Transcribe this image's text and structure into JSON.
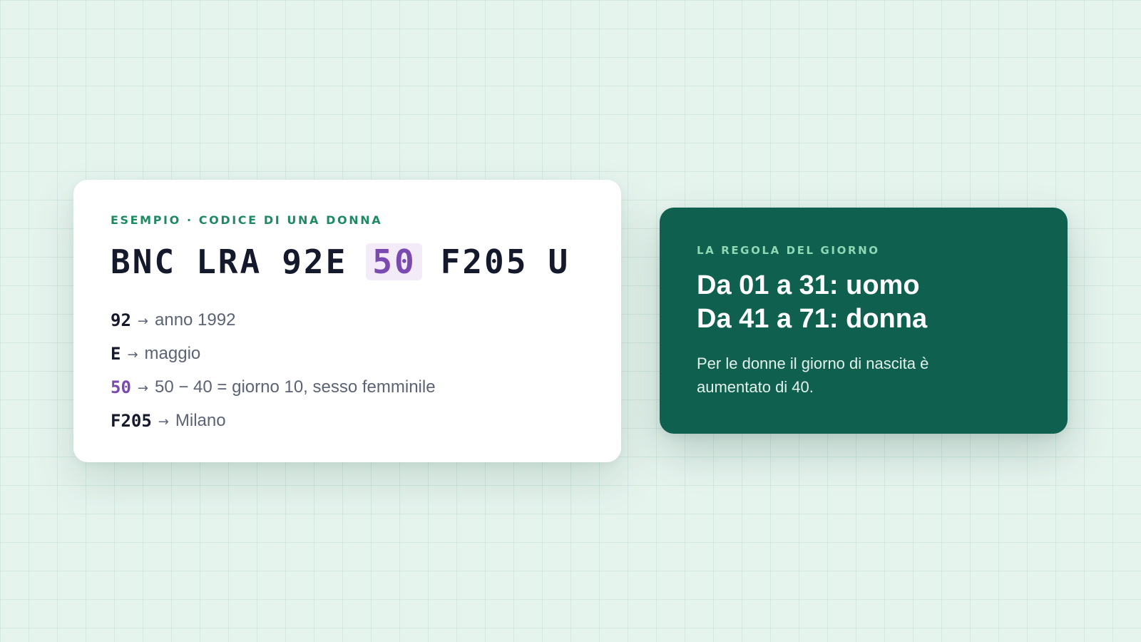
{
  "example": {
    "eyebrow": "ESEMPIO · CODICE DI UNA DONNA",
    "code": {
      "surname": "BNC",
      "name": "LRA",
      "year_month": "92E",
      "day": "50",
      "place": "F205",
      "check": "U"
    },
    "legend": [
      {
        "key": "92",
        "text": "anno 1992"
      },
      {
        "key": "E",
        "text": "maggio"
      },
      {
        "key": "50",
        "text": "50 − 40 = giorno 10, sesso femminile"
      },
      {
        "key": "F205",
        "text": "Milano"
      }
    ],
    "arrow": "→"
  },
  "rule": {
    "eyebrow": "LA REGOLA DEL GIORNO",
    "title_lines": [
      "Da 01 a 31: uomo",
      "Da 41 a 71: donna"
    ],
    "description": "Per le donne il giorno di nascita è aumentato di 40."
  },
  "colors": {
    "background": "#e6f4ee",
    "accent_green": "#1e8a62",
    "accent_purple": "#7a4ab0",
    "rule_card": "#0f604f",
    "rule_eyebrow": "#8fd8b4",
    "text_dark": "#141a2c",
    "text_muted": "#5b6374"
  }
}
